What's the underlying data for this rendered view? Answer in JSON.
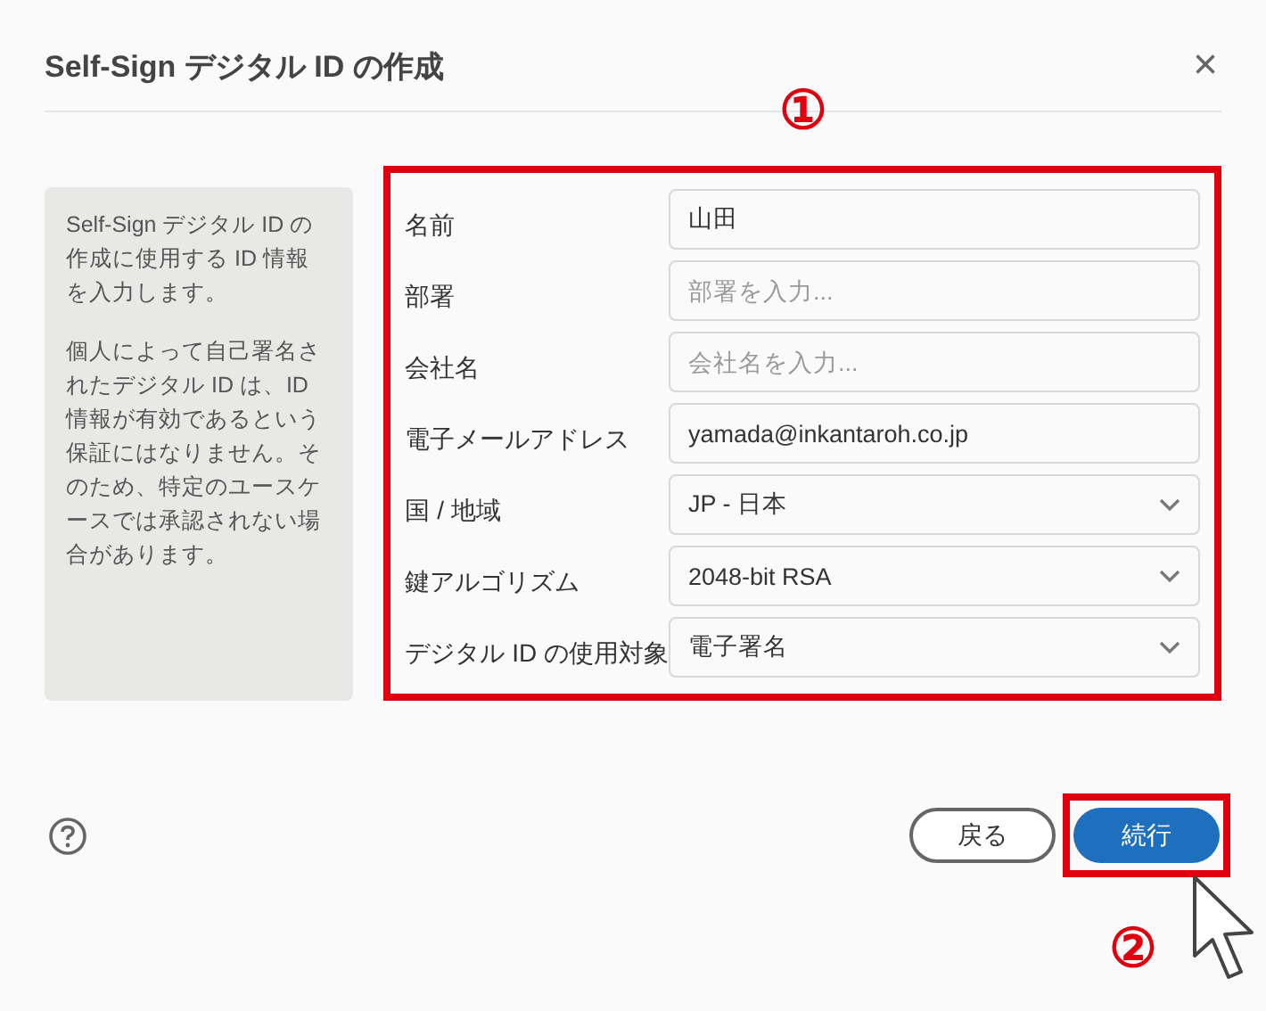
{
  "dialog": {
    "title": "Self-Sign デジタル ID の作成",
    "close": "×"
  },
  "info_panel": {
    "paragraphs": [
      "Self-Sign デジタル ID の作成に使用する ID 情報を入力します。",
      "個人によって自己署名されたデジタル ID は、ID 情報が有効であるという保証にはなりません。そのため、特定のユースケースでは承認されない場合があります。"
    ]
  },
  "form": {
    "fields": [
      {
        "label": "名前",
        "kind": "text",
        "value": "山田"
      },
      {
        "label": "部署",
        "kind": "text",
        "placeholder": "部署を入力..."
      },
      {
        "label": "会社名",
        "kind": "text",
        "placeholder": "会社名を入力..."
      },
      {
        "label": "電子メールアドレス",
        "kind": "text",
        "value": "yamada@inkantaroh.co.jp"
      },
      {
        "label": "国 / 地域",
        "kind": "select",
        "value": "JP - 日本"
      },
      {
        "label": "鍵アルゴリズム",
        "kind": "select",
        "value": "2048-bit RSA"
      },
      {
        "label": "デジタル ID の使用対象",
        "kind": "select",
        "value": "電子署名"
      }
    ]
  },
  "footer": {
    "buttons": [
      {
        "label": "戻る",
        "kind": "secondary"
      },
      {
        "label": "続行",
        "kind": "primary"
      }
    ]
  },
  "annotations": [
    {
      "marker": "①"
    },
    {
      "marker": "②"
    }
  ]
}
